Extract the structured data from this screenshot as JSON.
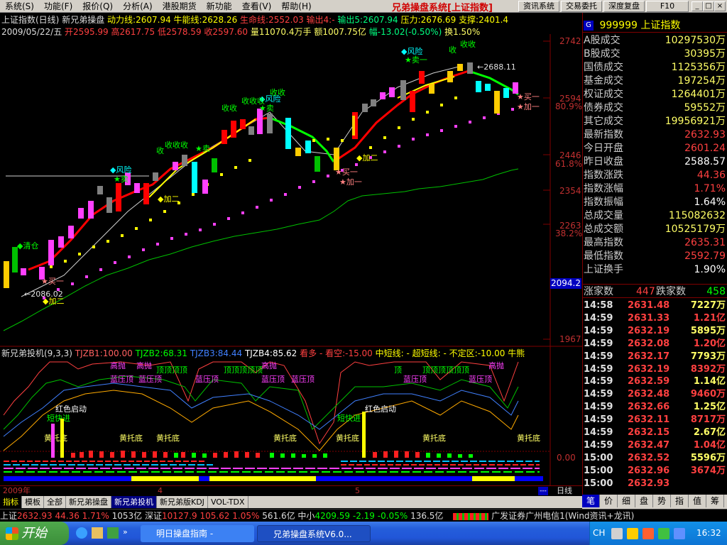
{
  "menu": [
    "系统(S)",
    "功能(F)",
    "报价(Q)",
    "分析(A)",
    "港股期货",
    "新功能",
    "查看(V)",
    "帮助(H)"
  ],
  "app_title": "兄弟操盘系统[上证指数]",
  "top_buttons": [
    "资讯系统",
    "交易委托",
    "深度复盘",
    "F10"
  ],
  "chart": {
    "info1": {
      "name": "上证指数(日线)",
      "sys": "新兄弟操盘",
      "dongli": "动力线:2607.94",
      "niuneng": "牛能线:2628.26",
      "shengming": "生命线:2552.03",
      "shuchu4": "输出4:-",
      "shuchu5": "输出5:2607.94",
      "yali": "压力:2676.69",
      "zhicheng": "支撑:2401.4"
    },
    "info2": {
      "date": "2009/05/22/五",
      "open": "开2595.99",
      "high": "高2617.75",
      "low": "低2578.59",
      "close": "收2597.60",
      "vol": "量11070.4万手",
      "amt": "额1007.75亿",
      "amp": "幅-13.02(-0.50%)",
      "hs": "换1.50%"
    },
    "price_axis": [
      "2742",
      "2594",
      "80.9%",
      "2446",
      "61.8%",
      "2354",
      "2263",
      "38.2%",
      "1967"
    ],
    "current_price_box": "2094.2",
    "annotations": [
      "风险",
      "卖一",
      "收",
      "收收",
      "收收收",
      "收收",
      "风险",
      "卖",
      "收收收收",
      "风险",
      "收",
      "风险",
      "卖一",
      "收收",
      "卖一",
      "加一",
      "加二",
      "买一",
      "加一",
      "清仓",
      "加二",
      "买一",
      "卖一",
      "加一",
      "2688.11",
      "2086.02"
    ],
    "indicator_info": {
      "name": "新兄弟投机(9,3,3)",
      "t1": "TJZB1:100.00",
      "t2": "TJZB2:68.31",
      "t3": "TJZB3:84.44",
      "t4": "TJZB4:85.62",
      "kan": "看多 - 看空:-15.00",
      "zhong": "中短线: - 超短线: - 不定区:-10.00 牛熊"
    },
    "indicator_labels": [
      "高抛",
      "高抛",
      "顶顶顶顶",
      "顶顶顶顶顶",
      "高抛",
      "顶顶顶",
      "顶顶顶顶",
      "高抛",
      "蓝压顶",
      "蓝压顶",
      "蓝压顶",
      "蓝压顶",
      "蓝压顶",
      "蓝压顶",
      "黄托底",
      "黄托底",
      "黄托底",
      "黄托底",
      "黄托底",
      "黄托底",
      "黄托底",
      "红色启动",
      "红色启动",
      "短快进",
      "短快进"
    ],
    "ind_axis": [
      "100.00",
      "0.00"
    ],
    "time_axis": [
      "2009年",
      "4",
      "5"
    ],
    "period": "日线"
  },
  "right_panel": {
    "code": "999999",
    "name": "上证指数",
    "rows": [
      {
        "label": "A股成交",
        "value": "10297530万",
        "color": "#ffff66"
      },
      {
        "label": "B股成交",
        "value": "30395万",
        "color": "#ffff66"
      },
      {
        "label": "国债成交",
        "value": "1125356万",
        "color": "#ffff66"
      },
      {
        "label": "基金成交",
        "value": "197254万",
        "color": "#ffff66"
      },
      {
        "label": "权证成交",
        "value": "1264401万",
        "color": "#ffff66"
      },
      {
        "label": "债券成交",
        "value": "59552万",
        "color": "#ffff66"
      },
      {
        "label": "其它成交",
        "value": "19956921万",
        "color": "#ffff66"
      },
      {
        "label": "最新指数",
        "value": "2632.93",
        "color": "#ff4040"
      },
      {
        "label": "今日开盘",
        "value": "2601.24",
        "color": "#ff4040"
      },
      {
        "label": "昨日收盘",
        "value": "2588.57",
        "color": "#ffffff"
      },
      {
        "label": "指数涨跌",
        "value": "44.36",
        "color": "#ff4040"
      },
      {
        "label": "指数涨幅",
        "value": "1.71%",
        "color": "#ff4040"
      },
      {
        "label": "指数振幅",
        "value": "1.64%",
        "color": "#ffffff"
      },
      {
        "label": "总成交量",
        "value": "115082632",
        "color": "#ffff66"
      },
      {
        "label": "总成交额",
        "value": "10525179万",
        "color": "#ffff66"
      },
      {
        "label": "最高指数",
        "value": "2635.31",
        "color": "#ff4040"
      },
      {
        "label": "最低指数",
        "value": "2592.79",
        "color": "#ff4040"
      },
      {
        "label": "上证换手",
        "value": "1.90%",
        "color": "#ffffff"
      }
    ],
    "updown": {
      "label1": "涨家数",
      "v1": "447",
      "label2": "跌家数",
      "v2": "458"
    },
    "ticks": [
      {
        "t": "14:58",
        "p": "2631.48",
        "q": "7227万"
      },
      {
        "t": "14:59",
        "p": "2631.33",
        "q": "1.21亿"
      },
      {
        "t": "14:59",
        "p": "2632.19",
        "q": "5895万"
      },
      {
        "t": "14:59",
        "p": "2632.08",
        "q": "1.20亿"
      },
      {
        "t": "14:59",
        "p": "2632.17",
        "q": "7793万"
      },
      {
        "t": "14:59",
        "p": "2632.19",
        "q": "8392万"
      },
      {
        "t": "14:59",
        "p": "2632.59",
        "q": "1.14亿"
      },
      {
        "t": "14:59",
        "p": "2632.48",
        "q": "9460万"
      },
      {
        "t": "14:59",
        "p": "2632.66",
        "q": "1.25亿"
      },
      {
        "t": "14:59",
        "p": "2632.11",
        "q": "8717万"
      },
      {
        "t": "14:59",
        "p": "2632.15",
        "q": "2.67亿"
      },
      {
        "t": "14:59",
        "p": "2632.47",
        "q": "1.04亿"
      },
      {
        "t": "15:00",
        "p": "2632.52",
        "q": "5596万"
      },
      {
        "t": "15:00",
        "p": "2632.96",
        "q": "3674万"
      },
      {
        "t": "15:00",
        "p": "2632.93",
        "q": ""
      }
    ],
    "tabs": [
      "笔",
      "价",
      "细",
      "盘",
      "势",
      "指",
      "值",
      "筹"
    ]
  },
  "tabbar": [
    "指标",
    "模板",
    "全部",
    "新兄弟操盘",
    "新兄弟投机",
    "新兄弟版KDJ",
    "VOL-TDX"
  ],
  "status": {
    "sh_label": "上证",
    "sh_val": "2632.93",
    "sh_chg": "44.36",
    "sh_pct": "1.71%",
    "sh_amt": "1053亿",
    "sz_label": "深证",
    "sz_val": "10127.9",
    "sz_chg": "105.62",
    "sz_pct": "1.05%",
    "sz_amt": "561.6亿",
    "zx_label": "中小",
    "zx_val": "4209.59",
    "zx_chg": "-2.19",
    "zx_pct": "-0.05%",
    "zx_amt": "136.5亿",
    "broker": "广发证券广州电信1(Wind资讯+龙讯)"
  },
  "taskbar": {
    "start": "开始",
    "tasks": [
      "明日操盘指南 -",
      "兄弟操盘系统V6.0..."
    ],
    "clock": "16:32",
    "lang": "CH"
  },
  "colors": {
    "up": "#ff4040",
    "down": "#00ffff",
    "bg": "#000000"
  }
}
